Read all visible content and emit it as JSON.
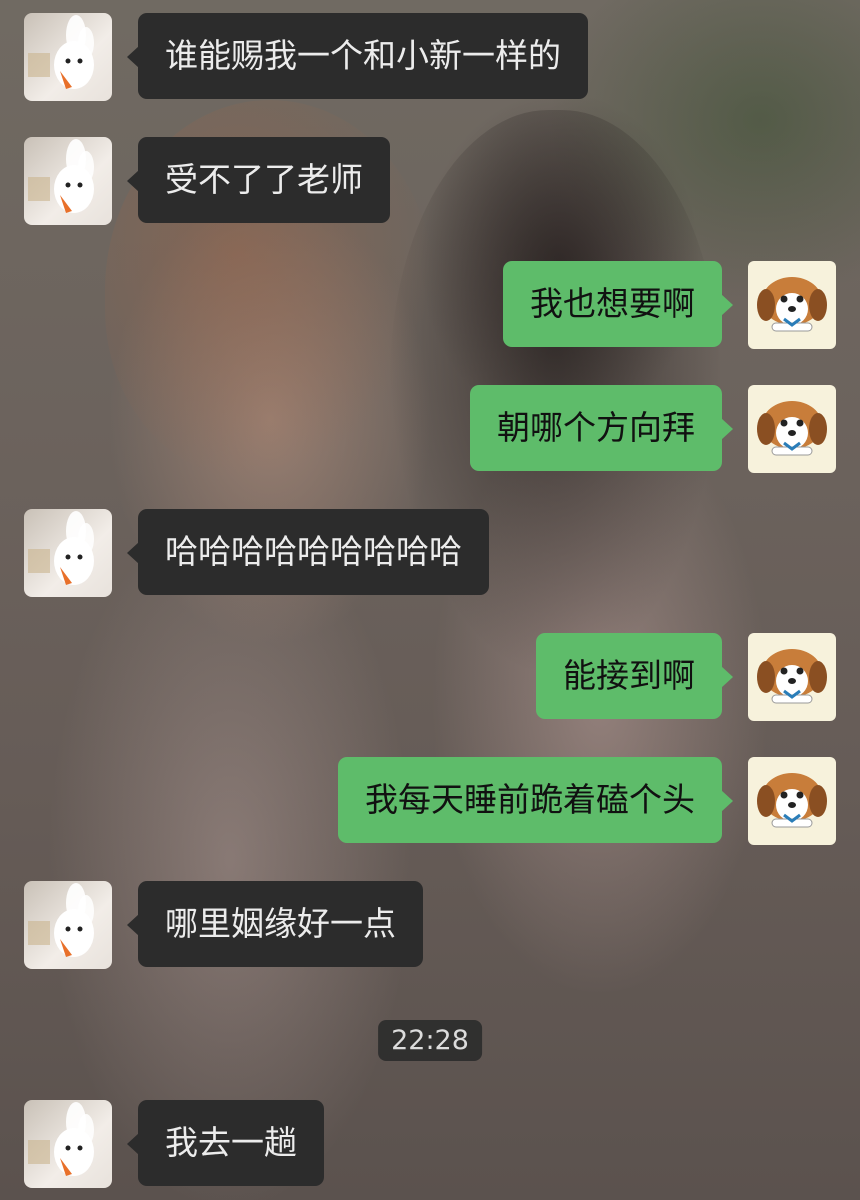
{
  "chat": {
    "messages": [
      {
        "side": "left",
        "avatar": "rabbit-avatar-icon",
        "text": "谁能赐我一个和小新一样的"
      },
      {
        "side": "left",
        "avatar": "rabbit-avatar-icon",
        "text": "受不了了老师"
      },
      {
        "side": "right",
        "avatar": "dog-avatar-icon",
        "text": "我也想要啊"
      },
      {
        "side": "right",
        "avatar": "dog-avatar-icon",
        "text": "朝哪个方向拜"
      },
      {
        "side": "left",
        "avatar": "rabbit-avatar-icon",
        "text": "哈哈哈哈哈哈哈哈哈"
      },
      {
        "side": "right",
        "avatar": "dog-avatar-icon",
        "text": "能接到啊"
      },
      {
        "side": "right",
        "avatar": "dog-avatar-icon",
        "text": "我每天睡前跪着磕个头"
      },
      {
        "side": "left",
        "avatar": "rabbit-avatar-icon",
        "text": "哪里姻缘好一点"
      },
      {
        "side": "left",
        "avatar": "rabbit-avatar-icon",
        "text": "我去一趟"
      }
    ],
    "timestamp": "22:28"
  },
  "colors": {
    "incoming_bubble": "#2c2c2c",
    "outgoing_bubble": "#5ebc6a",
    "incoming_text": "#ececec",
    "outgoing_text": "#111111"
  }
}
